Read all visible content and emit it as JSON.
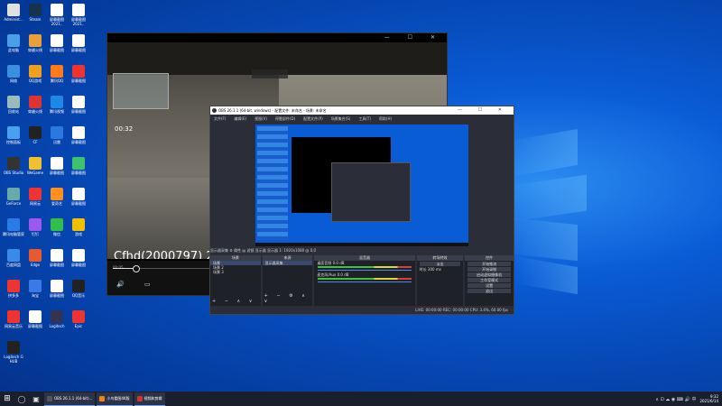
{
  "desktop": {
    "icons": [
      {
        "label": "Administ...",
        "color": "#e0e0e0"
      },
      {
        "label": "Steam",
        "color": "#17324d"
      },
      {
        "label": "屏幕截图 2021..",
        "color": "#ffffff"
      },
      {
        "label": "屏幕截图 2021..",
        "color": "#ffffff"
      },
      {
        "label": "此电脑",
        "color": "#4a9fe8"
      },
      {
        "label": "穿越火线",
        "color": "#e8a13a"
      },
      {
        "label": "屏幕截图",
        "color": "#ffffff"
      },
      {
        "label": "屏幕截图",
        "color": "#ffffff"
      },
      {
        "label": "网络",
        "color": "#3b8fe0"
      },
      {
        "label": "QQ游戏",
        "color": "#f0a020"
      },
      {
        "label": "腾讯QQ",
        "color": "#ff7a1a"
      },
      {
        "label": "屏幕截图",
        "color": "#e33"
      },
      {
        "label": "回收站",
        "color": "#9bb"
      },
      {
        "label": "穿越火线",
        "color": "#d33"
      },
      {
        "label": "腾讯视频",
        "color": "#1d88e5"
      },
      {
        "label": "屏幕截图",
        "color": "#ffffff"
      },
      {
        "label": "控制面板",
        "color": "#4aa0f0"
      },
      {
        "label": "CF",
        "color": "#222"
      },
      {
        "label": "迅雷",
        "color": "#2a78e0"
      },
      {
        "label": "屏幕截图",
        "color": "#ffffff"
      },
      {
        "label": "OBS Studio",
        "color": "#333"
      },
      {
        "label": "WeGame",
        "color": "#f0c030"
      },
      {
        "label": "屏幕截图",
        "color": "#ffffff"
      },
      {
        "label": "屏幕截图",
        "color": "#3cc36c"
      },
      {
        "label": "GeForce",
        "color": "#6aa"
      },
      {
        "label": "网易云",
        "color": "#e33"
      },
      {
        "label": "爱奇艺",
        "color": "#ff9020"
      },
      {
        "label": "屏幕截图",
        "color": "#ffffff"
      },
      {
        "label": "腾讯电脑管家",
        "color": "#2a7ae8"
      },
      {
        "label": "钉钉",
        "color": "#9b59f0"
      },
      {
        "label": "微信",
        "color": "#2fbf4a"
      },
      {
        "label": "游戏",
        "color": "#f0c000"
      },
      {
        "label": "百度网盘",
        "color": "#3a8ae8"
      },
      {
        "label": "Edge",
        "color": "#e65a30"
      },
      {
        "label": "屏幕截图",
        "color": "#ffffff"
      },
      {
        "label": "屏幕截图",
        "color": "#ffffff"
      },
      {
        "label": "拼多多",
        "color": "#e33"
      },
      {
        "label": "淘宝",
        "color": "#3a7ae8"
      },
      {
        "label": "屏幕截图",
        "color": "#ffffff"
      },
      {
        "label": "QQ音乐",
        "color": "#222"
      },
      {
        "label": "网易云音乐",
        "color": "#e33"
      },
      {
        "label": "屏幕截图",
        "color": "#ffffff"
      },
      {
        "label": "Logitech",
        "color": "#335"
      },
      {
        "label": "Epic",
        "color": "#e33"
      },
      {
        "label": "Logitech G HUB",
        "color": "#222"
      }
    ]
  },
  "player": {
    "titlebar_buttons": "— ☐ ✕",
    "timer": "00:32",
    "caption": "Cfhd(2000797) 2021.06.0",
    "elapsed": "00:05",
    "progress_fraction": 0.07,
    "controls": "🔊 ▭"
  },
  "obs": {
    "title": "OBS 26.1.1 (64-bit, windows) - 配置文件: 未命名 - 场景: 未命名",
    "win_buttons": "— ☐ ✕",
    "menu": [
      "文件(F)",
      "编辑(E)",
      "视图(V)",
      "停靠部件(D)",
      "配置文件(P)",
      "场景集合(S)",
      "工具(T)",
      "帮助(H)"
    ],
    "status_strip": "显示器采集   ⚙ 属性   ▤ 滤镜   显示器  显示器 1: 1920x1080 @ 0,0",
    "docks": {
      "scenes": {
        "header": "场景",
        "items": [
          "场景",
          "场景 2",
          "场景 3"
        ],
        "footer": "+ − ∧ ∨"
      },
      "sources": {
        "header": "来源",
        "items": [
          "显示器采集"
        ],
        "footer": "+ − ⚙ ∧ ∨"
      },
      "mixer": {
        "header": "混音器",
        "channels": [
          {
            "name": "桌面音频",
            "db": "0.0 dB"
          },
          {
            "name": "麦克风/Aux",
            "db": "0.0 dB"
          }
        ]
      },
      "transitions": {
        "header": "转场特效",
        "type": "淡出",
        "duration_label": "时长",
        "duration": "300 ms"
      },
      "controls": {
        "header": "控件",
        "buttons": [
          "开始推流",
          "开始录制",
          "启动虚拟摄像机",
          "工作室模式",
          "设置",
          "退出"
        ]
      }
    },
    "bottom_status": "LIVE: 00:00:00   REC: 00:00:00   CPU: 3.4%, 60.00 fps"
  },
  "taskbar": {
    "start": "⊞",
    "search": "◯",
    "taskview": "▣",
    "apps": [
      {
        "label": "OBS 26.1.1 (64-bit)...",
        "color": "#555"
      },
      {
        "label": "小鸟看图4K版",
        "color": "#f08020"
      },
      {
        "label": "视频和剪辑",
        "color": "#c33"
      }
    ],
    "tray": "∧ ⊡ ☁ ◉ ⌨ 🔊 中",
    "time": "9:32",
    "date": "2021/6/14"
  }
}
